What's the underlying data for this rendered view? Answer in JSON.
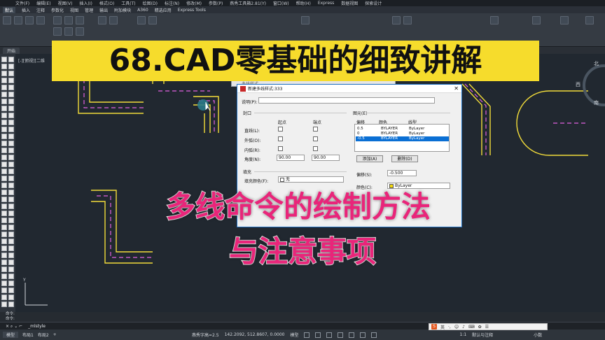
{
  "menubar": {
    "items": [
      "文件(F)",
      "编辑(E)",
      "视图(V)",
      "插入(I)",
      "格式(O)",
      "工具(T)",
      "绘图(D)",
      "标注(N)",
      "修改(M)",
      "参数(P)",
      "燕秀工具箱2.81(Y)",
      "窗口(W)",
      "帮助(H)",
      "Express",
      "数据视图",
      "探索设计"
    ]
  },
  "ribbon_tabs": {
    "items": [
      "默认",
      "插入",
      "注释",
      "参数化",
      "视图",
      "管理",
      "输出",
      "附加模块",
      "A360",
      "精选应用",
      "Express Tools"
    ],
    "active_index": 0
  },
  "file_tab": {
    "label": "开始"
  },
  "viewport": {
    "label": "[-][俯视][二维"
  },
  "title_caption": "68.CAD零基础的细致讲解",
  "subtitle_line1": "多线命令的绘制方法",
  "subtitle_line2": "与注意事项",
  "dialog_back": {
    "title": "多线样式"
  },
  "dialog": {
    "title": "新建多线样式:333",
    "close_glyph": "✕",
    "description_label": "说明(P):",
    "description_value": "",
    "caps": {
      "group_label": "封口",
      "col_start": "起点",
      "col_end": "端点",
      "rows": [
        "直线(L):",
        "外弧(O):",
        "内弧(R):"
      ],
      "angle_label": "角度(N):",
      "angle_start": "90.00",
      "angle_end": "90.00"
    },
    "fill": {
      "group_label": "填充",
      "color_label": "填充颜色(F):",
      "color_value": "无"
    },
    "elements": {
      "group_label": "图元(E)",
      "col_offset": "偏移",
      "col_color": "颜色",
      "col_linetype": "线型",
      "rows": [
        {
          "offset": "0.5",
          "color": "BYLAYER",
          "linetype": "ByLayer",
          "selected": false
        },
        {
          "offset": "0",
          "color": "BYLAYER",
          "linetype": "ByLayer",
          "selected": false
        },
        {
          "offset": "-0.5",
          "color": "BYLAYER",
          "linetype": "ByLayer",
          "selected": true
        }
      ],
      "add_button": "添加(A)",
      "delete_button": "删除(D)",
      "offset_label": "偏移(S):",
      "offset_value": "-0.500",
      "color_label": "颜色(C):",
      "color_value": "ByLayer"
    }
  },
  "compass": {
    "north": "北",
    "west": "西",
    "south": "南",
    "east": "东"
  },
  "command": {
    "history": [
      "命令:",
      "命令:"
    ],
    "current": "_mlstyle",
    "prompt_glyph": "×  ⌕  ⌄  ⌐"
  },
  "layout_tabs": [
    "模型",
    "布局1",
    "布局2"
  ],
  "status": {
    "font_text": "燕秀字高=2.5",
    "coords": "142.2092, 512.8607, 0.0000",
    "model_label": "模型",
    "annotation_scale": "1:1",
    "annotation_label": "默认与注释",
    "units": "小数"
  },
  "ime": {
    "badge": "S",
    "lang": "英"
  },
  "colors": {
    "title_band": "#f6dc2c",
    "subtitle": "#e9257a",
    "drawing_line": "#f2dc3a",
    "center_line": "#e060e0",
    "canvas": "#212830"
  }
}
